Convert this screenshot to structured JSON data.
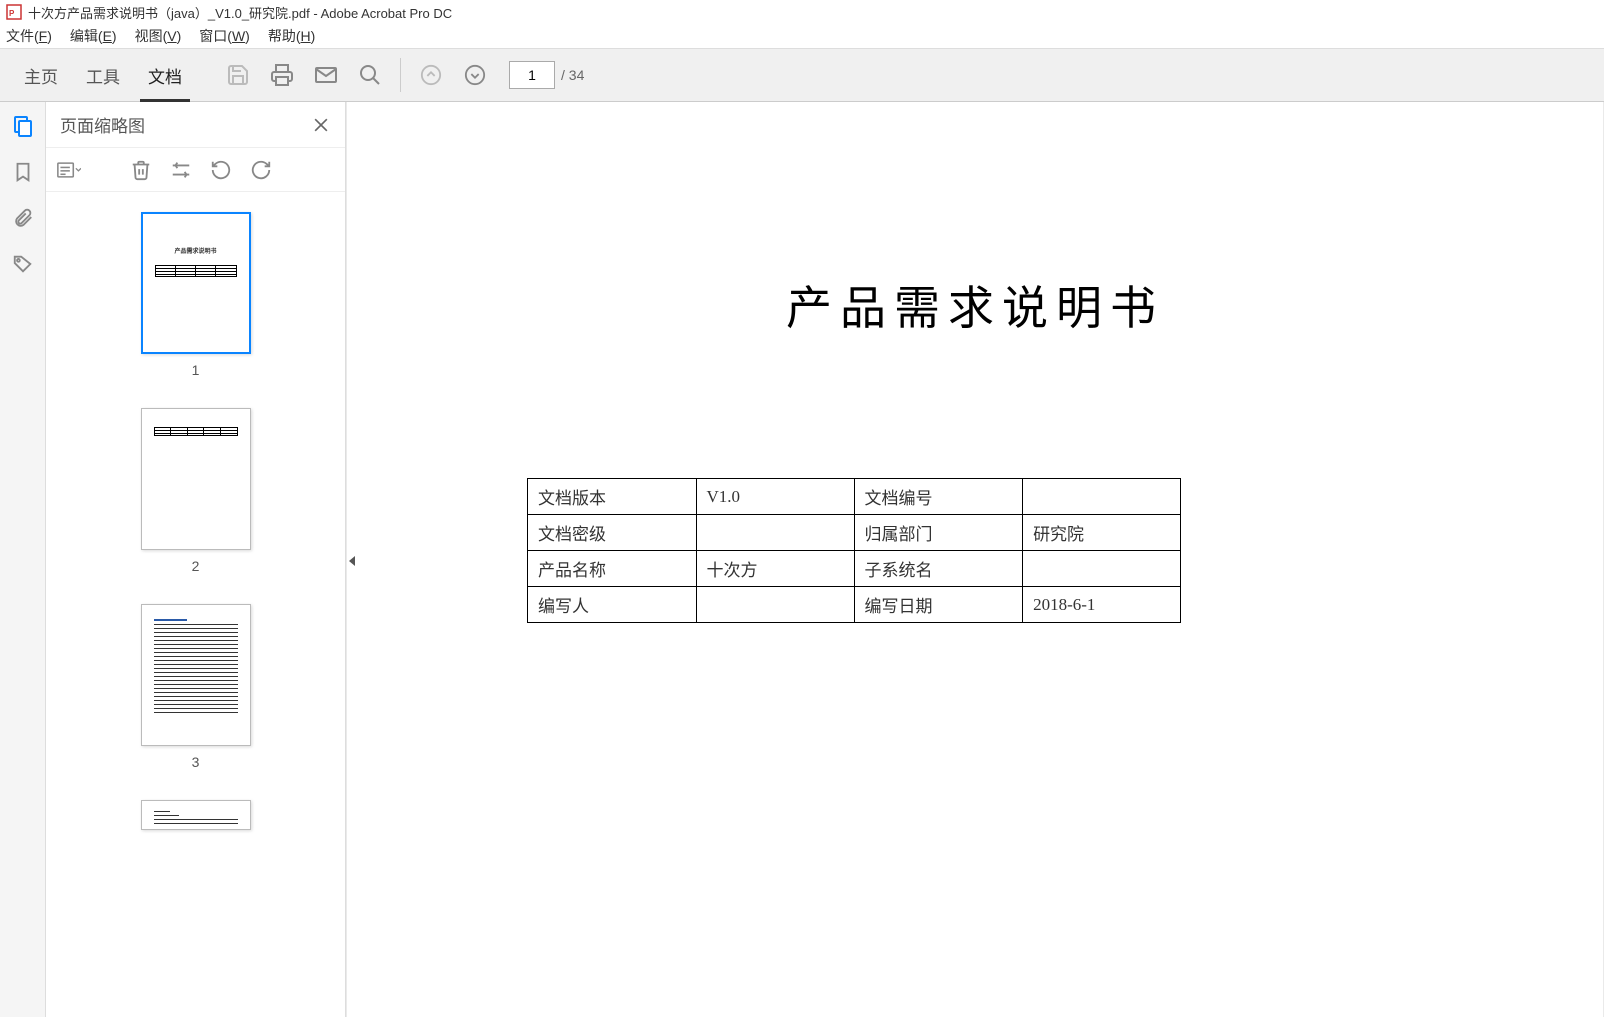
{
  "titlebar": {
    "filename": "十次方产品需求说明书（java）_V1.0_研究院.pdf",
    "app": "Adobe Acrobat Pro DC"
  },
  "menu": {
    "file": "文件(F)",
    "edit": "编辑(E)",
    "view": "视图(V)",
    "window": "窗口(W)",
    "help": "帮助(H)"
  },
  "tabs": {
    "home": "主页",
    "tools": "工具",
    "document": "文档"
  },
  "paging": {
    "current": "1",
    "total": "/ 34"
  },
  "thumb_panel": {
    "title": "页面缩略图",
    "pages": [
      "1",
      "2",
      "3"
    ]
  },
  "document": {
    "title": "产品需求说明书",
    "table": {
      "r1c1": "文档版本",
      "r1c2": "V1.0",
      "r1c3": "文档编号",
      "r1c4": "",
      "r2c1": "文档密级",
      "r2c2": "",
      "r2c3": "归属部门",
      "r2c4": "研究院",
      "r3c1": "产品名称",
      "r3c2": "十次方",
      "r3c3": "子系统名",
      "r3c4": "",
      "r4c1": "编写人",
      "r4c2": "",
      "r4c3": "编写日期",
      "r4c4": "2018-6-1"
    }
  },
  "thumb_mini": {
    "t1": "产品需求说明书"
  }
}
